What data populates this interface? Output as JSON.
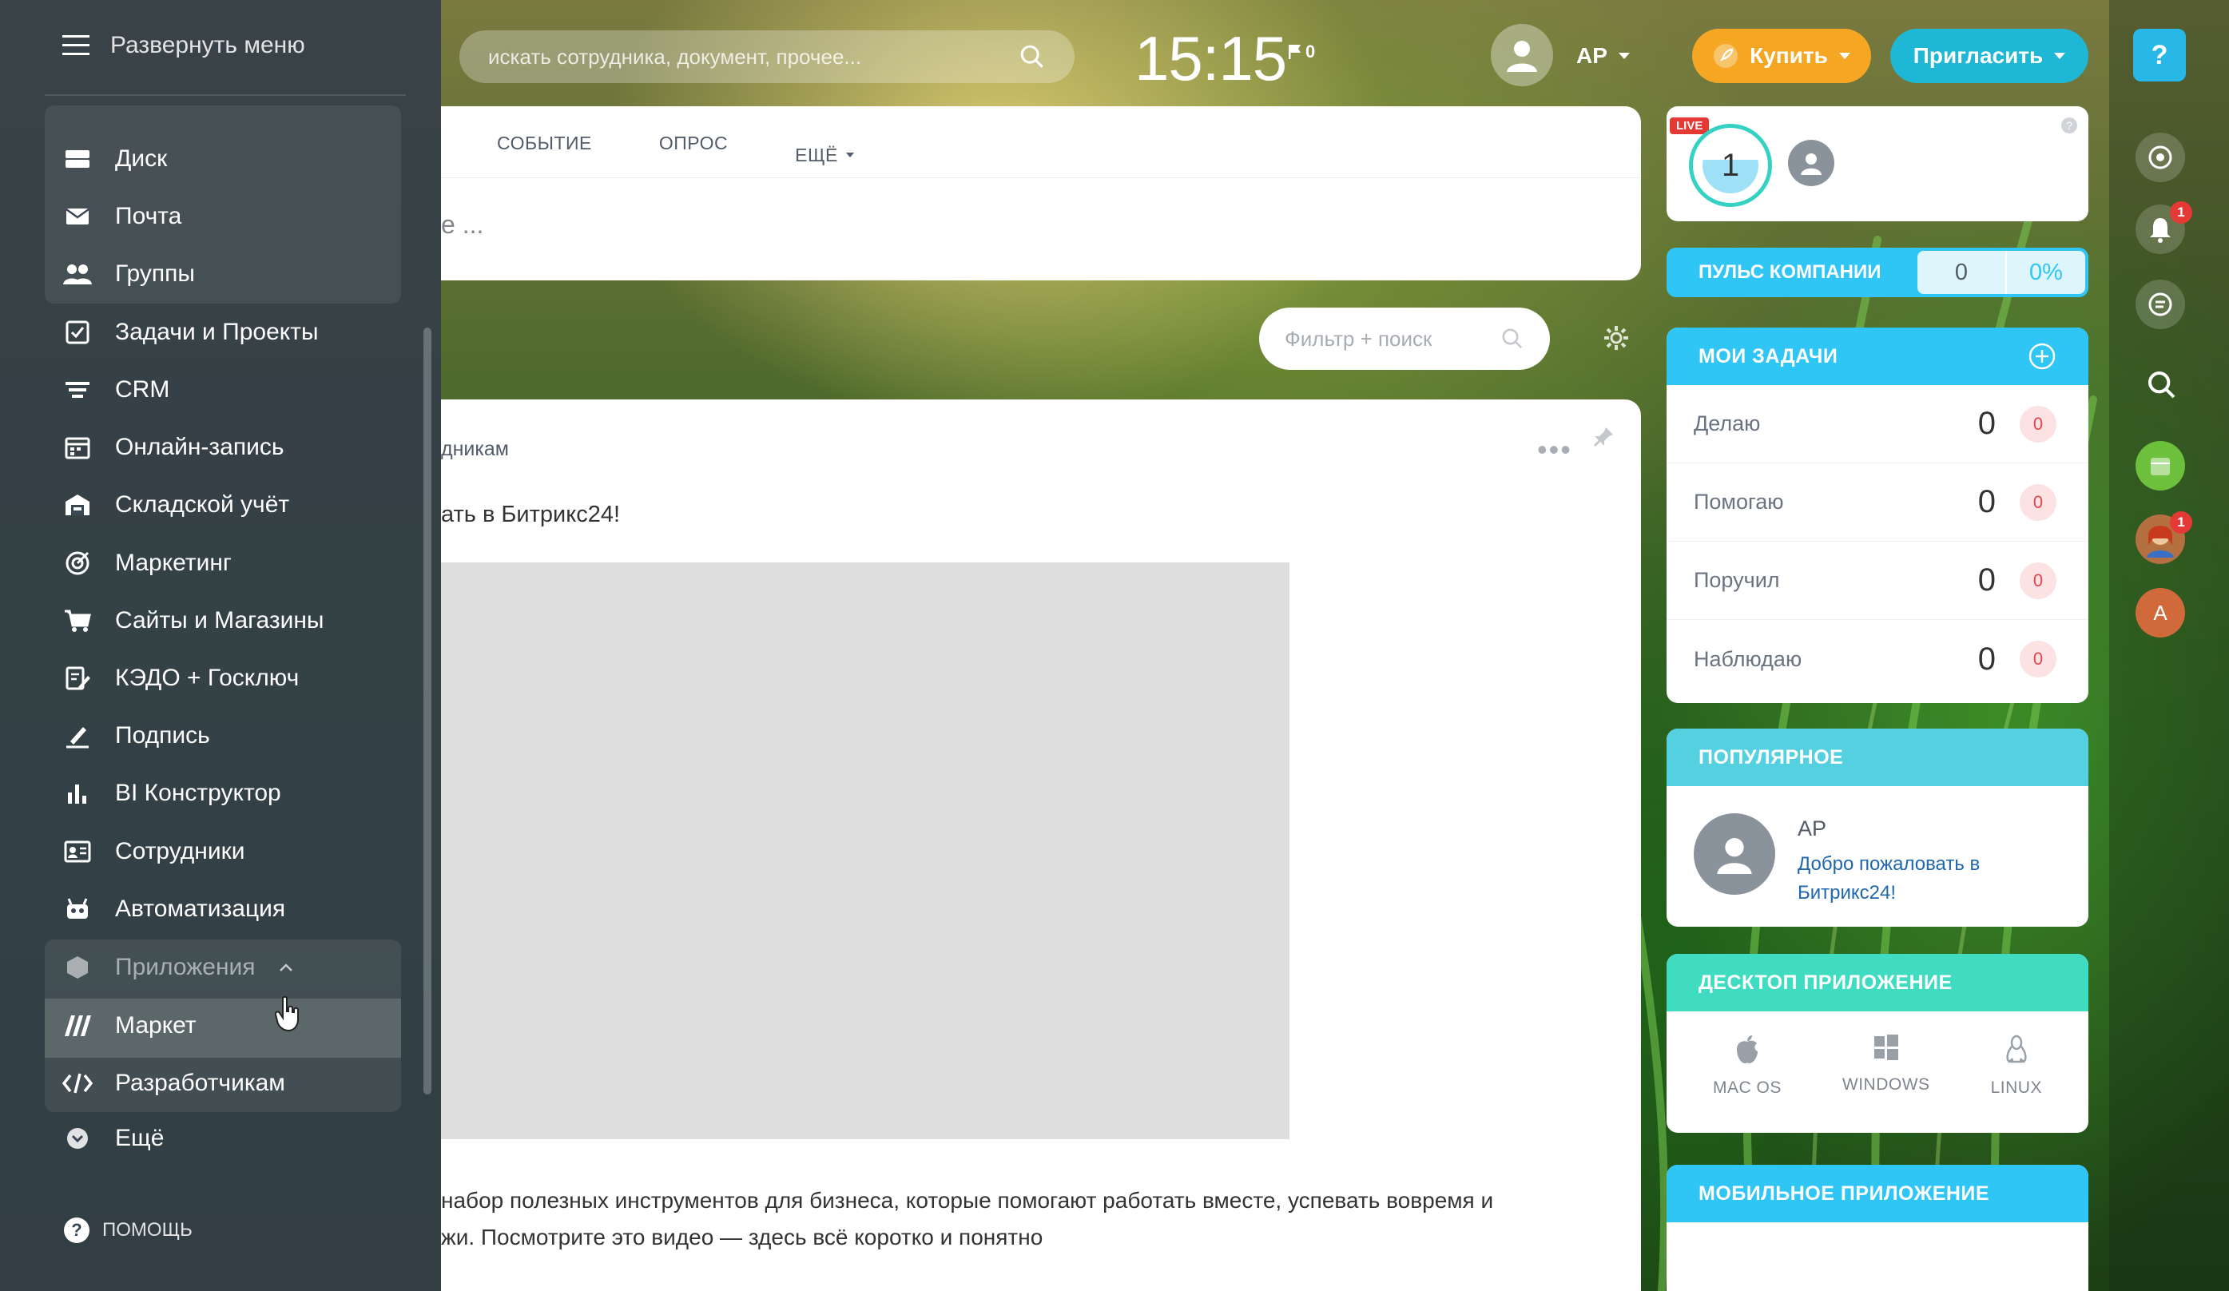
{
  "top": {
    "search_placeholder": "искать сотрудника, документ, прочее...",
    "clock": "15:15",
    "flag_count": "0",
    "user": "АР",
    "buy_label": "Купить",
    "invite_label": "Пригласить"
  },
  "sidebar": {
    "header": "Развернуть меню",
    "items": [
      {
        "label": "Диск",
        "icon": "disk-icon"
      },
      {
        "label": "Почта",
        "icon": "mail-icon"
      },
      {
        "label": "Группы",
        "icon": "groups-icon"
      },
      {
        "label": "Задачи и Проекты",
        "icon": "tasks-icon"
      },
      {
        "label": "CRM",
        "icon": "crm-icon"
      },
      {
        "label": "Онлайн-запись",
        "icon": "booking-icon"
      },
      {
        "label": "Складской учёт",
        "icon": "warehouse-icon"
      },
      {
        "label": "Маркетинг",
        "icon": "marketing-icon"
      },
      {
        "label": "Сайты и Магазины",
        "icon": "cart-icon"
      },
      {
        "label": "КЭДО + Госключ",
        "icon": "edo-icon"
      },
      {
        "label": "Подпись",
        "icon": "signature-icon"
      },
      {
        "label": "BI Конструктор",
        "icon": "bi-icon"
      },
      {
        "label": "Сотрудники",
        "icon": "employees-icon"
      },
      {
        "label": "Автоматизация",
        "icon": "robot-icon"
      },
      {
        "label": "Приложения",
        "icon": "apps-icon"
      },
      {
        "label": "Маркет",
        "icon": "market-icon"
      },
      {
        "label": "Разработчикам",
        "icon": "code-icon"
      },
      {
        "label": "Ещё",
        "icon": "chevron-circle-icon"
      }
    ],
    "help": "ПОМОЩЬ"
  },
  "composer": {
    "tabs": [
      "СОБЫТИЕ",
      "ОПРОС",
      "ЕЩЁ"
    ],
    "placeholder": "е ..."
  },
  "feed": {
    "filter_placeholder": "Фильтр + поиск",
    "post_author": "дникам",
    "post_title": "ать в Битрикс24!",
    "post_text_1": "набор полезных инструментов для бизнеса, которые помогают работать вместе, успевать вовремя и",
    "post_text_2": "жи. Посмотрите это видео — здесь всё коротко и понятно"
  },
  "live": {
    "badge": "LIVE",
    "count": "1",
    "help": "?"
  },
  "pulse": {
    "label": "ПУЛЬС КОМПАНИИ",
    "value": "0",
    "percent": "0%"
  },
  "tasks": {
    "title": "МОИ ЗАДАЧИ",
    "rows": [
      {
        "label": "Делаю",
        "count": "0",
        "counter": "0"
      },
      {
        "label": "Помогаю",
        "count": "0",
        "counter": "0"
      },
      {
        "label": "Поручил",
        "count": "0",
        "counter": "0"
      },
      {
        "label": "Наблюдаю",
        "count": "0",
        "counter": "0"
      }
    ]
  },
  "popular": {
    "title": "ПОПУЛЯРНОЕ",
    "author": "АР",
    "link": "Добро пожаловать в Битрикс24!"
  },
  "desktop": {
    "title": "ДЕСКТОП ПРИЛОЖЕНИЕ",
    "os": [
      "MAC OS",
      "WINDOWS",
      "LINUX"
    ]
  },
  "mobile": {
    "title": "МОБИЛЬНОЕ ПРИЛОЖЕНИЕ"
  },
  "rail": {
    "help": "?",
    "notif_badge": "1",
    "avatar_badge": "1",
    "avatar_letter": "А"
  },
  "colors": {
    "accent": "#2fc6f6",
    "buy": "#f5a623",
    "invite": "#1eb8d6",
    "live": "#e53935",
    "sidebar": "#343e48"
  }
}
